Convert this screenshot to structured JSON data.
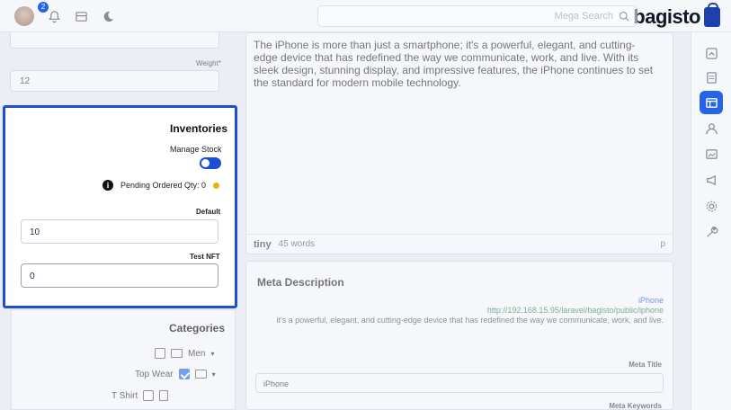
{
  "header": {
    "logo_text": "bagisto",
    "search_placeholder": "Mega Search",
    "notification_count": "2"
  },
  "sidebar": {
    "items": [
      {
        "icon": "dashboard-icon"
      },
      {
        "icon": "sales-icon"
      },
      {
        "icon": "catalog-icon",
        "active": true
      },
      {
        "icon": "customers-icon"
      },
      {
        "icon": "cms-icon"
      },
      {
        "icon": "marketing-icon"
      },
      {
        "icon": "settings-icon"
      },
      {
        "icon": "configure-icon"
      }
    ]
  },
  "editor": {
    "content": "The iPhone is more than just a smartphone; it's a powerful, elegant, and cutting-edge device that has redefined the way we communicate, work, and live. With its sleek design, stunning display, and impressive features, the iPhone continues to set the standard for modern mobile technology.",
    "word_count": "45 words",
    "brand": "tiny",
    "path": "p"
  },
  "meta": {
    "title": "Meta Description",
    "preview_title": "iPhone",
    "preview_url": "http://192.168.15.95/laravel/bagisto/public/iphone",
    "preview_desc": "it's a powerful, elegant, and cutting-edge device that has redefined the way we communicate, work, and live.",
    "meta_title_label": "Meta Title",
    "meta_title_value": "iPhone",
    "meta_keywords_label": "Meta Keywords"
  },
  "weight": {
    "label": "Weight*",
    "value": "12"
  },
  "inventories": {
    "title": "Inventories",
    "manage_stock_label": "Manage Stock",
    "manage_stock_on": true,
    "pending_text": "Pending Ordered Qty: 0",
    "default_label": "Default",
    "default_value": "10",
    "test_nft_label": "Test NFT",
    "test_nft_value": "0"
  },
  "categories": {
    "title": "Categories",
    "items": [
      {
        "label": "Men",
        "checked": false
      },
      {
        "label": "Top Wear",
        "checked": true
      },
      {
        "label": "T Shirt",
        "checked": false
      }
    ]
  },
  "colors": {
    "accent": "#1d4ed8",
    "pending_dot": "#eab308"
  }
}
